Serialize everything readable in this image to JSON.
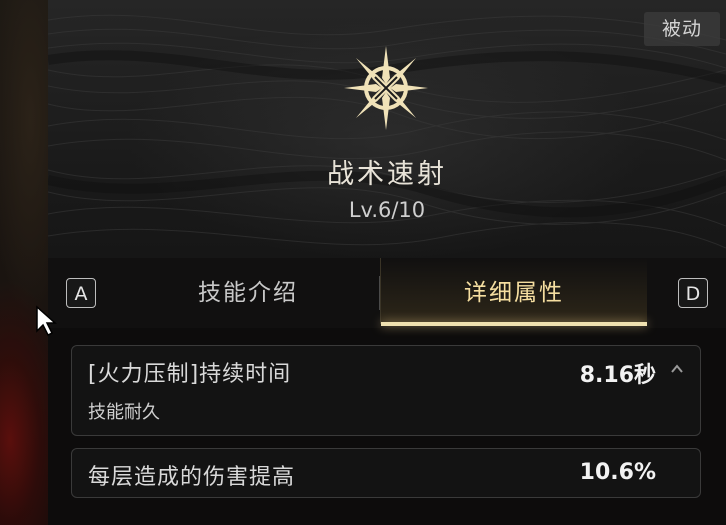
{
  "header": {
    "passive_tag": "被动",
    "skill_icon": "star-compass-icon",
    "skill_name": "战术速射",
    "skill_level": "Lv.6/10"
  },
  "tabs": {
    "left_key": "A",
    "right_key": "D",
    "items": [
      {
        "label": "技能介绍",
        "active": false
      },
      {
        "label": "详细属性",
        "active": true
      }
    ]
  },
  "attributes": [
    {
      "title": "[火力压制]持续时间",
      "value": "8.16秒",
      "subtitle": "技能耐久",
      "expanded": true
    },
    {
      "title": "每层造成的伤害提高",
      "value": "10.6%"
    }
  ],
  "colors": {
    "active_tab": "#f5dea0",
    "icon_gold": "#f0e2b8",
    "panel_bg": "#0d0c0c"
  }
}
